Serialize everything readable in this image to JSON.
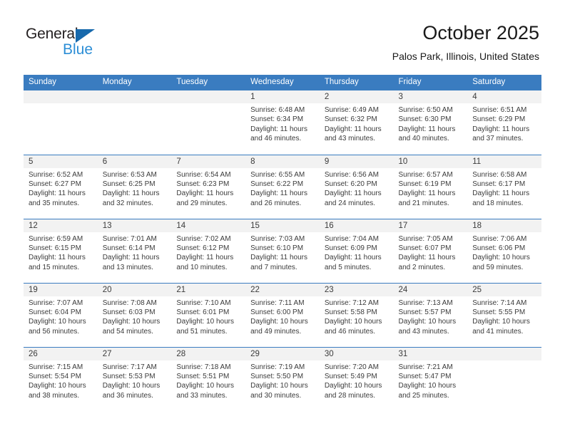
{
  "brand": {
    "name_part1": "General",
    "name_part2": "Blue",
    "triangle_icon": "blue-triangle-icon"
  },
  "header": {
    "title": "October 2025",
    "location": "Palos Park, Illinois, United States"
  },
  "colors": {
    "header_blue": "#3a7cc0",
    "brand_blue": "#2c8ed6",
    "logo_triangle": "#1769ac",
    "daynum_band": "#f2f2f2",
    "text": "#3b3b3b"
  },
  "calendar": {
    "day_headers": [
      "Sunday",
      "Monday",
      "Tuesday",
      "Wednesday",
      "Thursday",
      "Friday",
      "Saturday"
    ],
    "weeks": [
      [
        {
          "day": "",
          "empty": true
        },
        {
          "day": "",
          "empty": true
        },
        {
          "day": "",
          "empty": true
        },
        {
          "day": "1",
          "sunrise": "Sunrise: 6:48 AM",
          "sunset": "Sunset: 6:34 PM",
          "daylight": "Daylight: 11 hours and 46 minutes."
        },
        {
          "day": "2",
          "sunrise": "Sunrise: 6:49 AM",
          "sunset": "Sunset: 6:32 PM",
          "daylight": "Daylight: 11 hours and 43 minutes."
        },
        {
          "day": "3",
          "sunrise": "Sunrise: 6:50 AM",
          "sunset": "Sunset: 6:30 PM",
          "daylight": "Daylight: 11 hours and 40 minutes."
        },
        {
          "day": "4",
          "sunrise": "Sunrise: 6:51 AM",
          "sunset": "Sunset: 6:29 PM",
          "daylight": "Daylight: 11 hours and 37 minutes."
        }
      ],
      [
        {
          "day": "5",
          "sunrise": "Sunrise: 6:52 AM",
          "sunset": "Sunset: 6:27 PM",
          "daylight": "Daylight: 11 hours and 35 minutes."
        },
        {
          "day": "6",
          "sunrise": "Sunrise: 6:53 AM",
          "sunset": "Sunset: 6:25 PM",
          "daylight": "Daylight: 11 hours and 32 minutes."
        },
        {
          "day": "7",
          "sunrise": "Sunrise: 6:54 AM",
          "sunset": "Sunset: 6:23 PM",
          "daylight": "Daylight: 11 hours and 29 minutes."
        },
        {
          "day": "8",
          "sunrise": "Sunrise: 6:55 AM",
          "sunset": "Sunset: 6:22 PM",
          "daylight": "Daylight: 11 hours and 26 minutes."
        },
        {
          "day": "9",
          "sunrise": "Sunrise: 6:56 AM",
          "sunset": "Sunset: 6:20 PM",
          "daylight": "Daylight: 11 hours and 24 minutes."
        },
        {
          "day": "10",
          "sunrise": "Sunrise: 6:57 AM",
          "sunset": "Sunset: 6:19 PM",
          "daylight": "Daylight: 11 hours and 21 minutes."
        },
        {
          "day": "11",
          "sunrise": "Sunrise: 6:58 AM",
          "sunset": "Sunset: 6:17 PM",
          "daylight": "Daylight: 11 hours and 18 minutes."
        }
      ],
      [
        {
          "day": "12",
          "sunrise": "Sunrise: 6:59 AM",
          "sunset": "Sunset: 6:15 PM",
          "daylight": "Daylight: 11 hours and 15 minutes."
        },
        {
          "day": "13",
          "sunrise": "Sunrise: 7:01 AM",
          "sunset": "Sunset: 6:14 PM",
          "daylight": "Daylight: 11 hours and 13 minutes."
        },
        {
          "day": "14",
          "sunrise": "Sunrise: 7:02 AM",
          "sunset": "Sunset: 6:12 PM",
          "daylight": "Daylight: 11 hours and 10 minutes."
        },
        {
          "day": "15",
          "sunrise": "Sunrise: 7:03 AM",
          "sunset": "Sunset: 6:10 PM",
          "daylight": "Daylight: 11 hours and 7 minutes."
        },
        {
          "day": "16",
          "sunrise": "Sunrise: 7:04 AM",
          "sunset": "Sunset: 6:09 PM",
          "daylight": "Daylight: 11 hours and 5 minutes."
        },
        {
          "day": "17",
          "sunrise": "Sunrise: 7:05 AM",
          "sunset": "Sunset: 6:07 PM",
          "daylight": "Daylight: 11 hours and 2 minutes."
        },
        {
          "day": "18",
          "sunrise": "Sunrise: 7:06 AM",
          "sunset": "Sunset: 6:06 PM",
          "daylight": "Daylight: 10 hours and 59 minutes."
        }
      ],
      [
        {
          "day": "19",
          "sunrise": "Sunrise: 7:07 AM",
          "sunset": "Sunset: 6:04 PM",
          "daylight": "Daylight: 10 hours and 56 minutes."
        },
        {
          "day": "20",
          "sunrise": "Sunrise: 7:08 AM",
          "sunset": "Sunset: 6:03 PM",
          "daylight": "Daylight: 10 hours and 54 minutes."
        },
        {
          "day": "21",
          "sunrise": "Sunrise: 7:10 AM",
          "sunset": "Sunset: 6:01 PM",
          "daylight": "Daylight: 10 hours and 51 minutes."
        },
        {
          "day": "22",
          "sunrise": "Sunrise: 7:11 AM",
          "sunset": "Sunset: 6:00 PM",
          "daylight": "Daylight: 10 hours and 49 minutes."
        },
        {
          "day": "23",
          "sunrise": "Sunrise: 7:12 AM",
          "sunset": "Sunset: 5:58 PM",
          "daylight": "Daylight: 10 hours and 46 minutes."
        },
        {
          "day": "24",
          "sunrise": "Sunrise: 7:13 AM",
          "sunset": "Sunset: 5:57 PM",
          "daylight": "Daylight: 10 hours and 43 minutes."
        },
        {
          "day": "25",
          "sunrise": "Sunrise: 7:14 AM",
          "sunset": "Sunset: 5:55 PM",
          "daylight": "Daylight: 10 hours and 41 minutes."
        }
      ],
      [
        {
          "day": "26",
          "sunrise": "Sunrise: 7:15 AM",
          "sunset": "Sunset: 5:54 PM",
          "daylight": "Daylight: 10 hours and 38 minutes."
        },
        {
          "day": "27",
          "sunrise": "Sunrise: 7:17 AM",
          "sunset": "Sunset: 5:53 PM",
          "daylight": "Daylight: 10 hours and 36 minutes."
        },
        {
          "day": "28",
          "sunrise": "Sunrise: 7:18 AM",
          "sunset": "Sunset: 5:51 PM",
          "daylight": "Daylight: 10 hours and 33 minutes."
        },
        {
          "day": "29",
          "sunrise": "Sunrise: 7:19 AM",
          "sunset": "Sunset: 5:50 PM",
          "daylight": "Daylight: 10 hours and 30 minutes."
        },
        {
          "day": "30",
          "sunrise": "Sunrise: 7:20 AM",
          "sunset": "Sunset: 5:49 PM",
          "daylight": "Daylight: 10 hours and 28 minutes."
        },
        {
          "day": "31",
          "sunrise": "Sunrise: 7:21 AM",
          "sunset": "Sunset: 5:47 PM",
          "daylight": "Daylight: 10 hours and 25 minutes."
        },
        {
          "day": "",
          "empty": true
        }
      ]
    ]
  }
}
